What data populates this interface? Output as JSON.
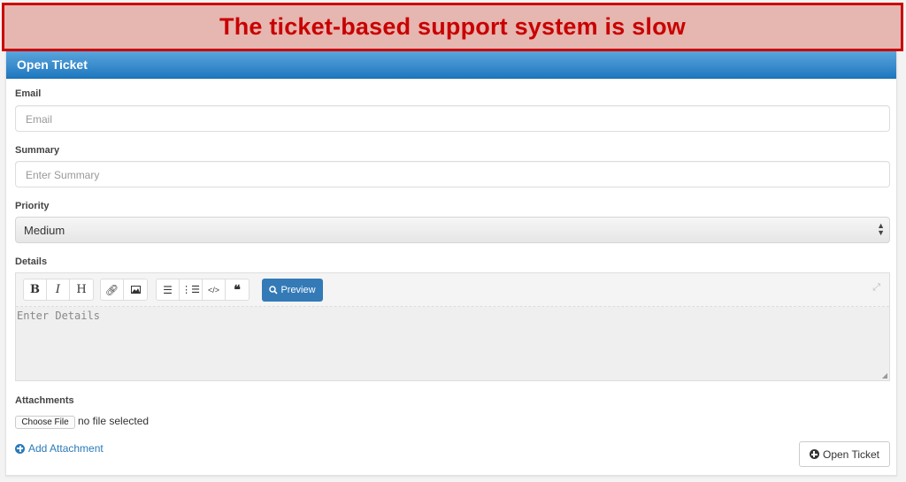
{
  "banner": {
    "text": "The ticket-based support system is slow"
  },
  "panel": {
    "title": "Open Ticket"
  },
  "form": {
    "email": {
      "label": "Email",
      "placeholder": "Email",
      "value": ""
    },
    "summary": {
      "label": "Summary",
      "placeholder": "Enter Summary",
      "value": ""
    },
    "priority": {
      "label": "Priority",
      "selected": "Medium"
    },
    "details": {
      "label": "Details",
      "placeholder": "Enter Details",
      "toolbar": {
        "bold": "B",
        "italic": "I",
        "heading": "H",
        "link_icon": "link-icon",
        "image_icon": "image-icon",
        "ul_icon": "unordered-list-icon",
        "ol_icon": "ordered-list-icon",
        "code_icon": "code-icon",
        "quote_icon": "quote-icon",
        "preview_label": "Preview",
        "fullscreen_icon": "expand-icon"
      }
    },
    "attachments": {
      "label": "Attachments",
      "choose_file_label": "Choose File",
      "file_status": "no file selected",
      "add_attachment_label": "Add Attachment"
    },
    "submit_label": "Open Ticket"
  },
  "colors": {
    "banner_text": "#c80000",
    "banner_bg": "#e6b6b0",
    "header_blue": "#1f78bf",
    "primary": "#337ab7",
    "link": "#2a7ab8"
  }
}
